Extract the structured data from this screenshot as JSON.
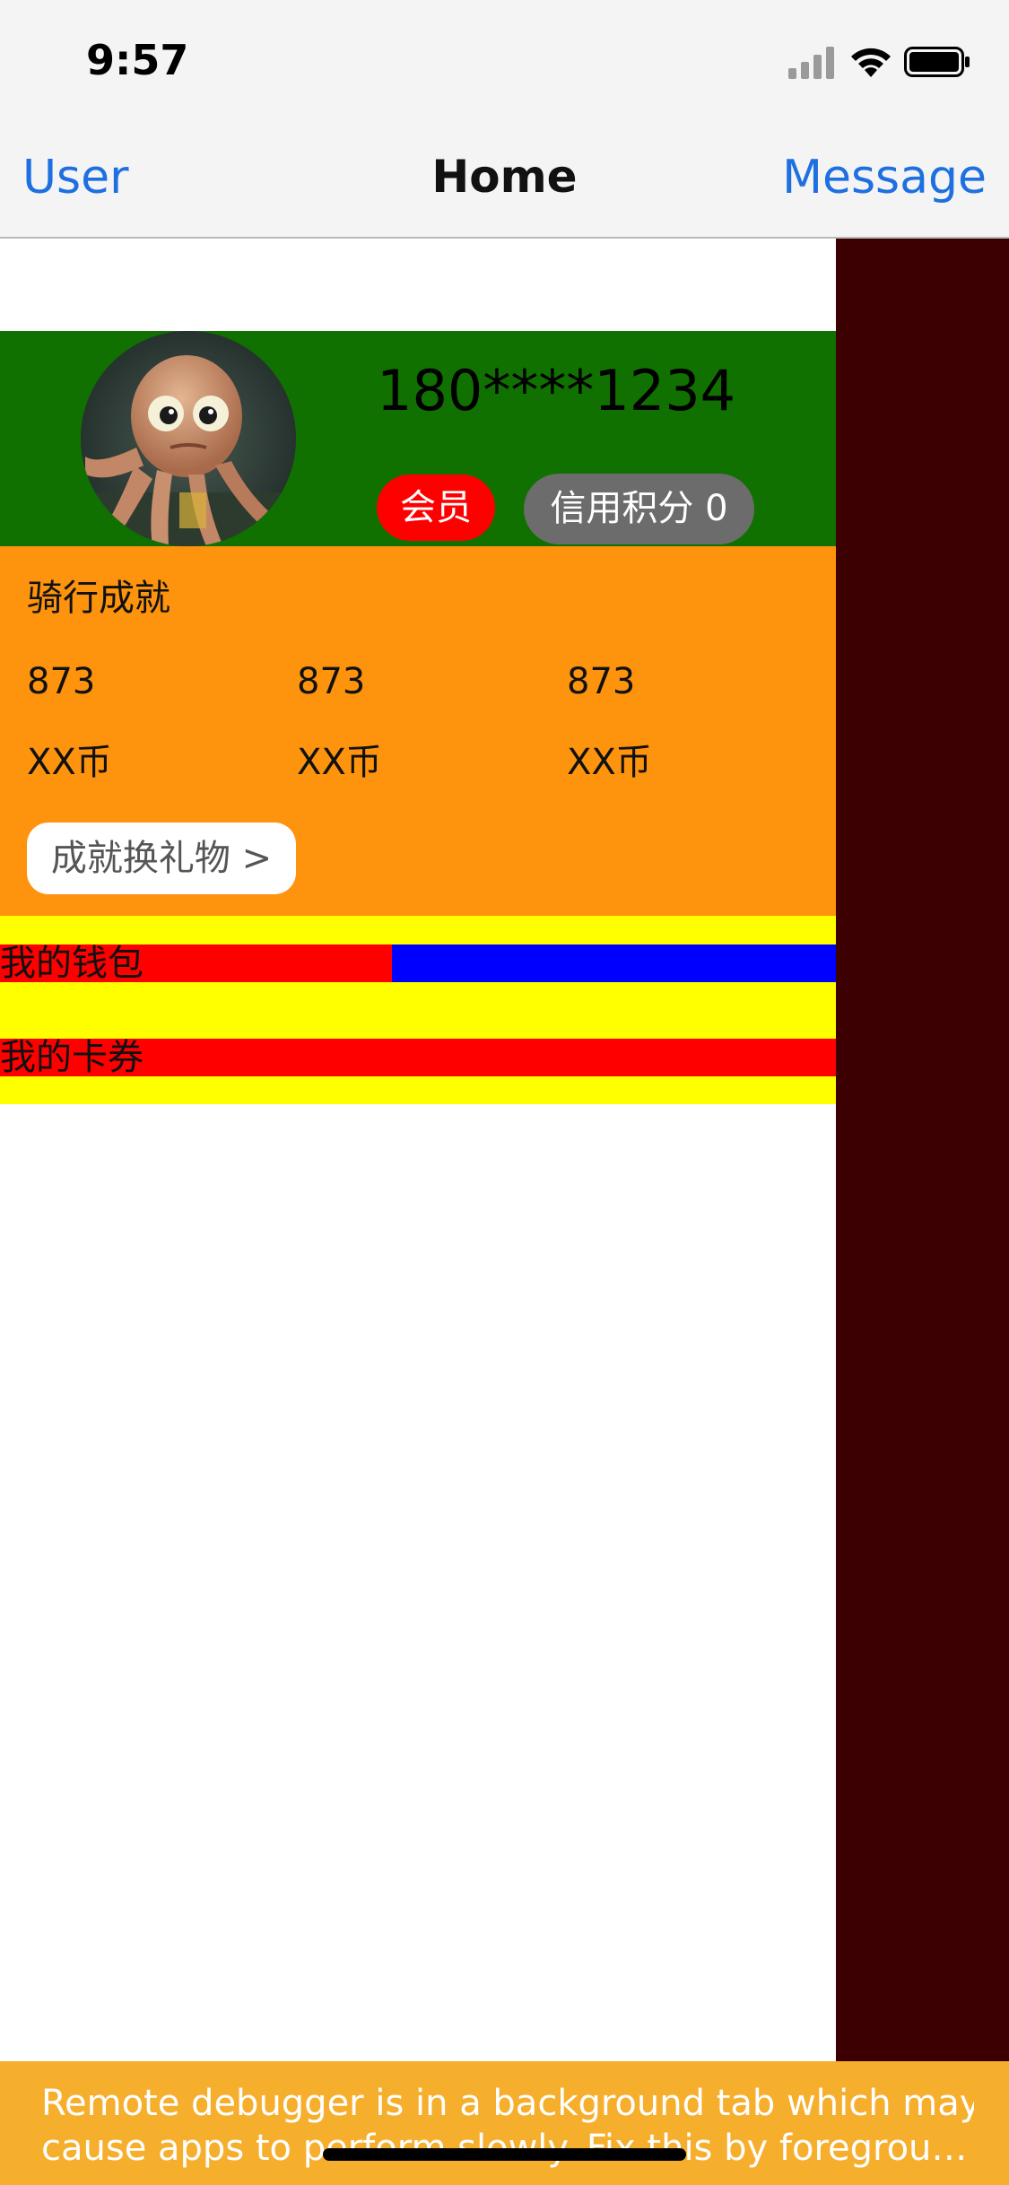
{
  "status_bar": {
    "time": "9:57"
  },
  "nav": {
    "left": "User",
    "title": "Home",
    "right": "Message"
  },
  "profile": {
    "phone": "180****1234",
    "member_badge": "会员",
    "credit_badge": "信用积分 0"
  },
  "achievement": {
    "title": "骑行成就",
    "items": [
      {
        "value": "873",
        "unit": "XX币"
      },
      {
        "value": "873",
        "unit": "XX币"
      },
      {
        "value": "873",
        "unit": "XX币"
      }
    ],
    "exchange_button": "成就换礼物 >"
  },
  "list": {
    "wallet": "我的钱包",
    "coupon": "我的卡券"
  },
  "debug_banner": {
    "line1": "Remote debugger is in a background tab which may",
    "line2": "cause apps to perform slowly. Fix this by foregroun…"
  },
  "colors": {
    "nav_link": "#1e6fe0",
    "profile_bg": "#107000",
    "achievement_bg": "#fe930d",
    "list_bg": "#ffff00",
    "side_panel": "#3c0002",
    "debug_banner": "#f6ae2d"
  }
}
